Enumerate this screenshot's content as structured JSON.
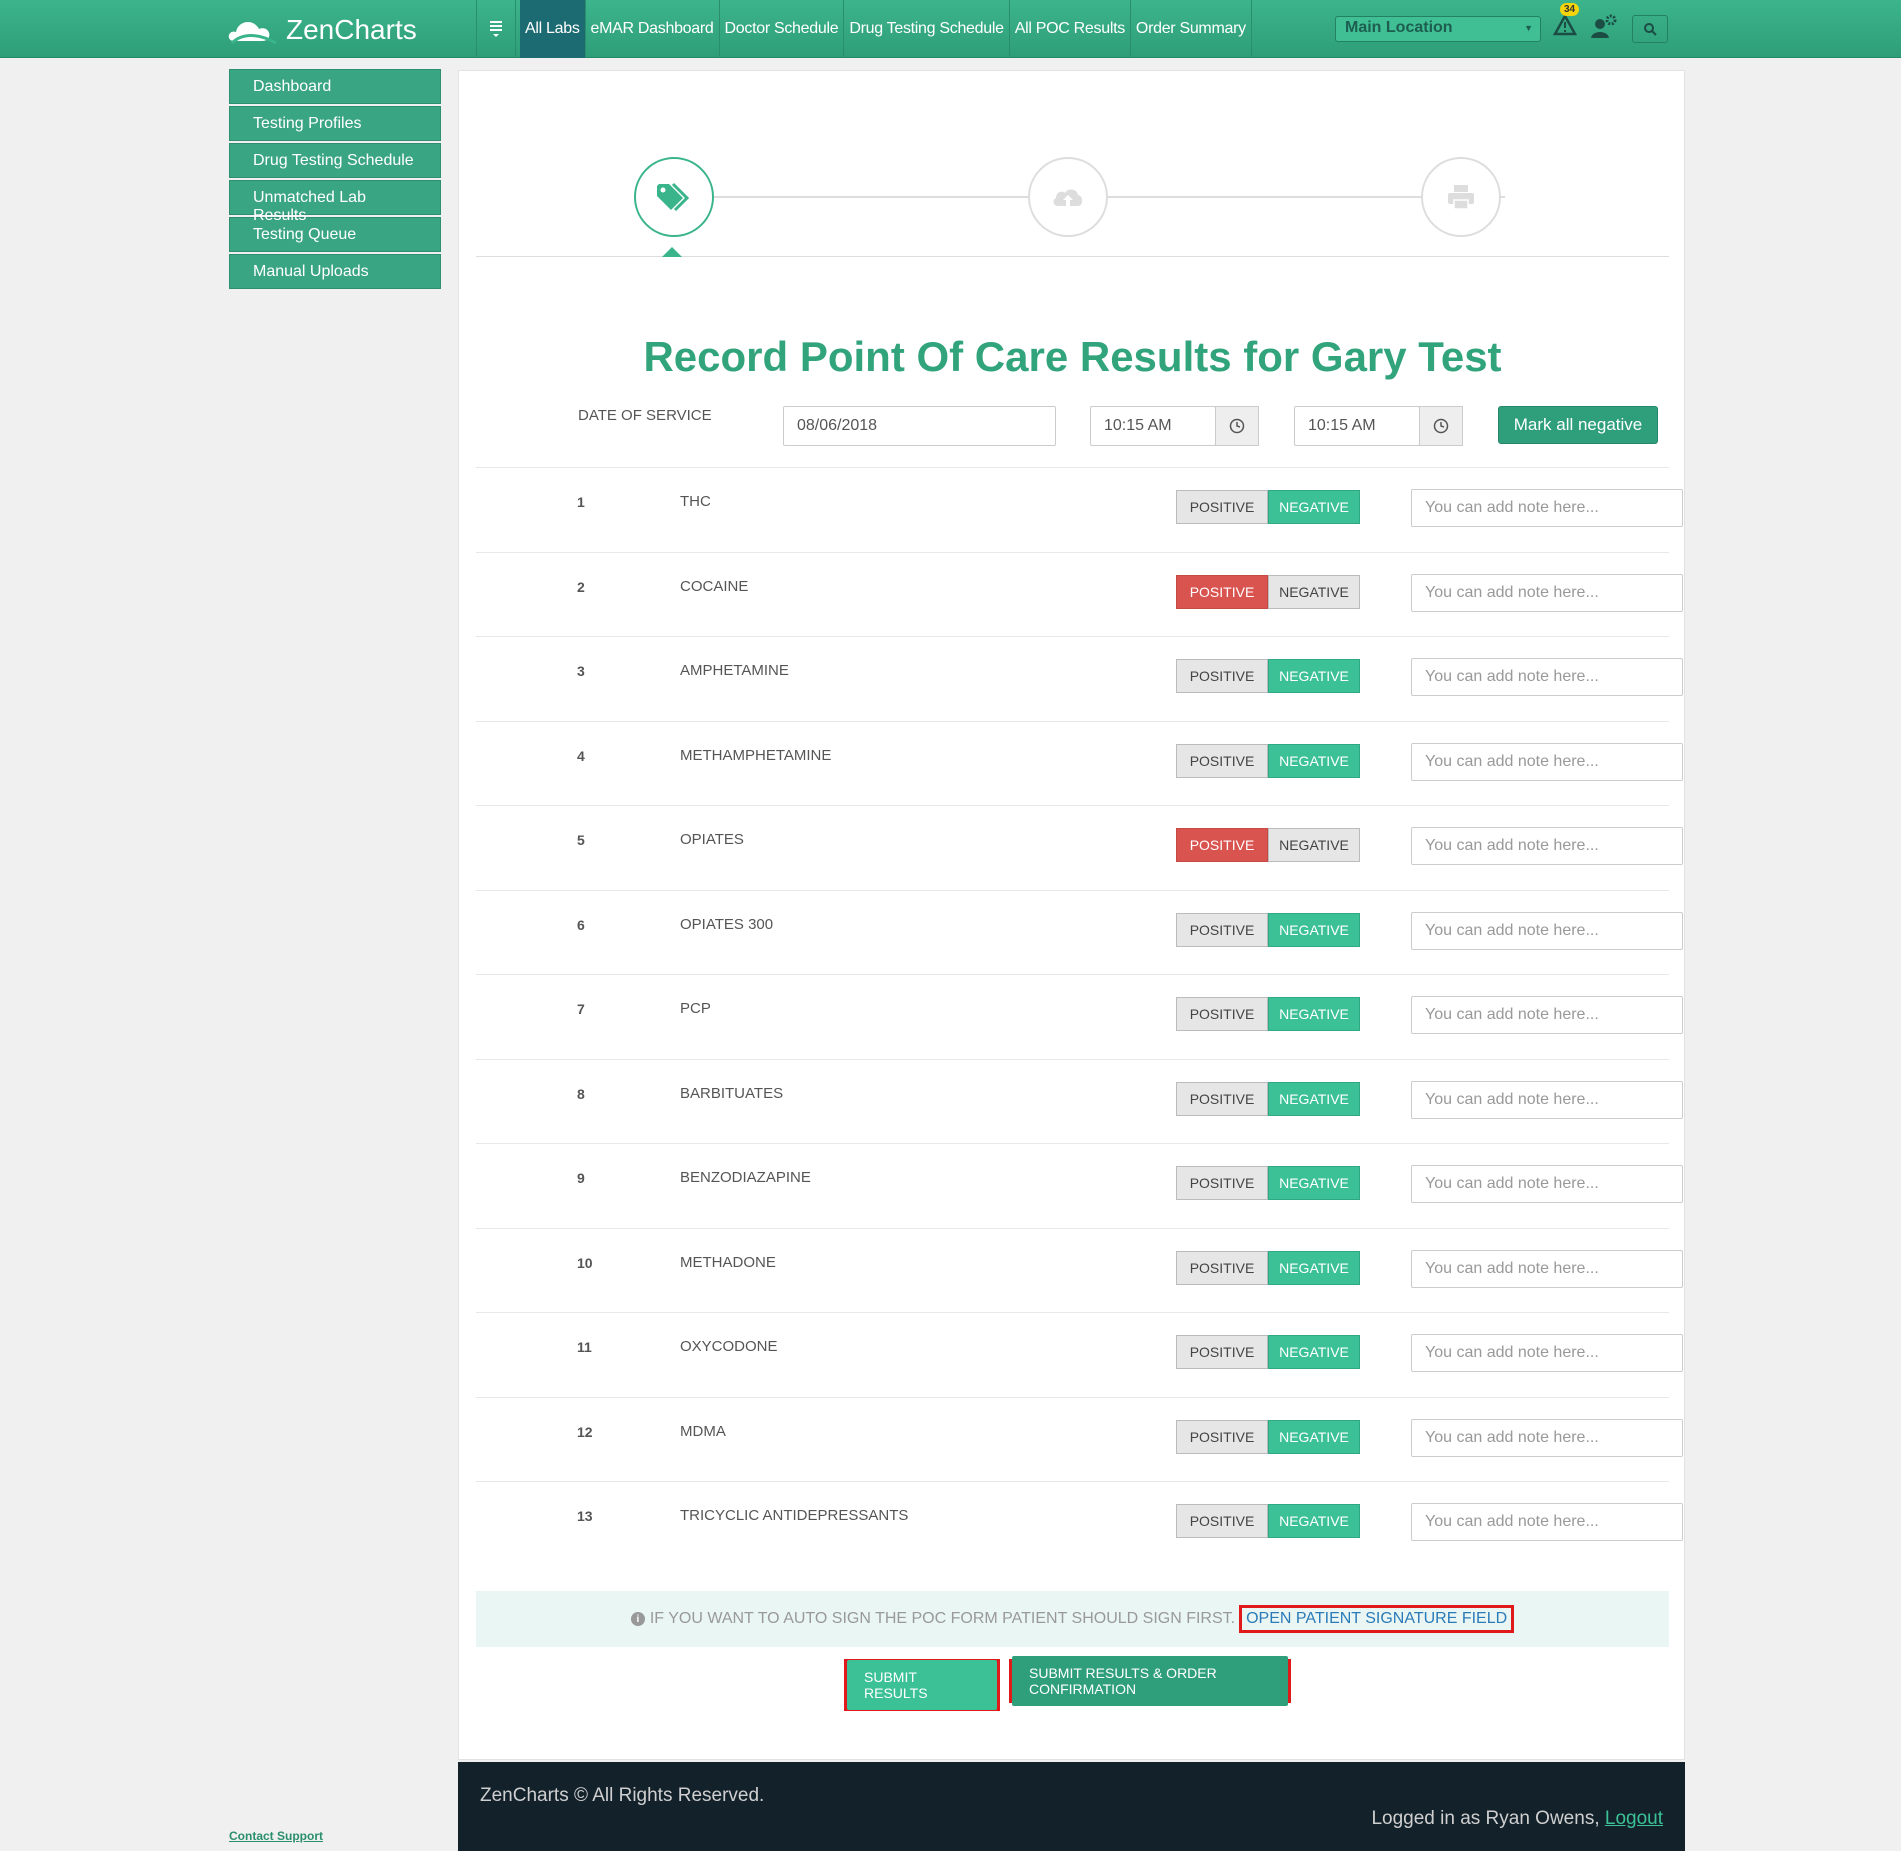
{
  "app": {
    "name": "ZenCharts"
  },
  "nav": {
    "menu_icon": "hamburger-icon",
    "items": [
      "All Labs",
      "eMAR Dashboard",
      "Doctor Schedule",
      "Drug Testing Schedule",
      "All POC Results",
      "Order Summary"
    ],
    "location": "Main Location",
    "alert_count": "34"
  },
  "sidebar": {
    "items": [
      "Dashboard",
      "Testing Profiles",
      "Drug Testing Schedule",
      "Unmatched Lab Results",
      "Testing Queue",
      "Manual Uploads"
    ],
    "contact": "Contact Support"
  },
  "wizard": {
    "steps": [
      "tag-icon",
      "cloud-upload-icon",
      "print-icon"
    ],
    "active": 0
  },
  "page": {
    "title": "Record Point Of Care Results for Gary Test",
    "dos_label": "DATE OF SERVICE",
    "date": "08/06/2018",
    "time_start": "10:15 AM",
    "time_end": "10:15 AM",
    "mark_all": "Mark all negative",
    "positive_label": "POSITIVE",
    "negative_label": "NEGATIVE",
    "note_placeholder": "You can add note here...",
    "tests": [
      {
        "num": "1",
        "name": "THC",
        "result": "negative"
      },
      {
        "num": "2",
        "name": "COCAINE",
        "result": "positive"
      },
      {
        "num": "3",
        "name": "AMPHETAMINE",
        "result": "negative"
      },
      {
        "num": "4",
        "name": "METHAMPHETAMINE",
        "result": "negative"
      },
      {
        "num": "5",
        "name": "OPIATES",
        "result": "positive"
      },
      {
        "num": "6",
        "name": "OPIATES 300",
        "result": "negative"
      },
      {
        "num": "7",
        "name": "PCP",
        "result": "negative"
      },
      {
        "num": "8",
        "name": "BARBITUATES",
        "result": "negative"
      },
      {
        "num": "9",
        "name": "BENZODIAZAPINE",
        "result": "negative"
      },
      {
        "num": "10",
        "name": "METHADONE",
        "result": "negative"
      },
      {
        "num": "11",
        "name": "OXYCODONE",
        "result": "negative"
      },
      {
        "num": "12",
        "name": "MDMA",
        "result": "negative"
      },
      {
        "num": "13",
        "name": "TRICYCLIC ANTIDEPRESSANTS",
        "result": "negative"
      }
    ],
    "info_text": "IF YOU WANT TO AUTO SIGN THE POC FORM PATIENT SHOULD SIGN FIRST.",
    "info_link": "OPEN PATIENT SIGNATURE FIELD",
    "submit": "SUBMIT RESULTS",
    "submit_order": "SUBMIT RESULTS & ORDER CONFIRMATION"
  },
  "footer": {
    "copyright": "ZenCharts © All Rights Reserved.",
    "logged_in": "Logged in as Ryan Owens,",
    "logout": "Logout"
  },
  "colors": {
    "brand": "#3ab58b",
    "positive": "#d9534f",
    "negative": "#3cc196",
    "footer": "#13212b"
  }
}
